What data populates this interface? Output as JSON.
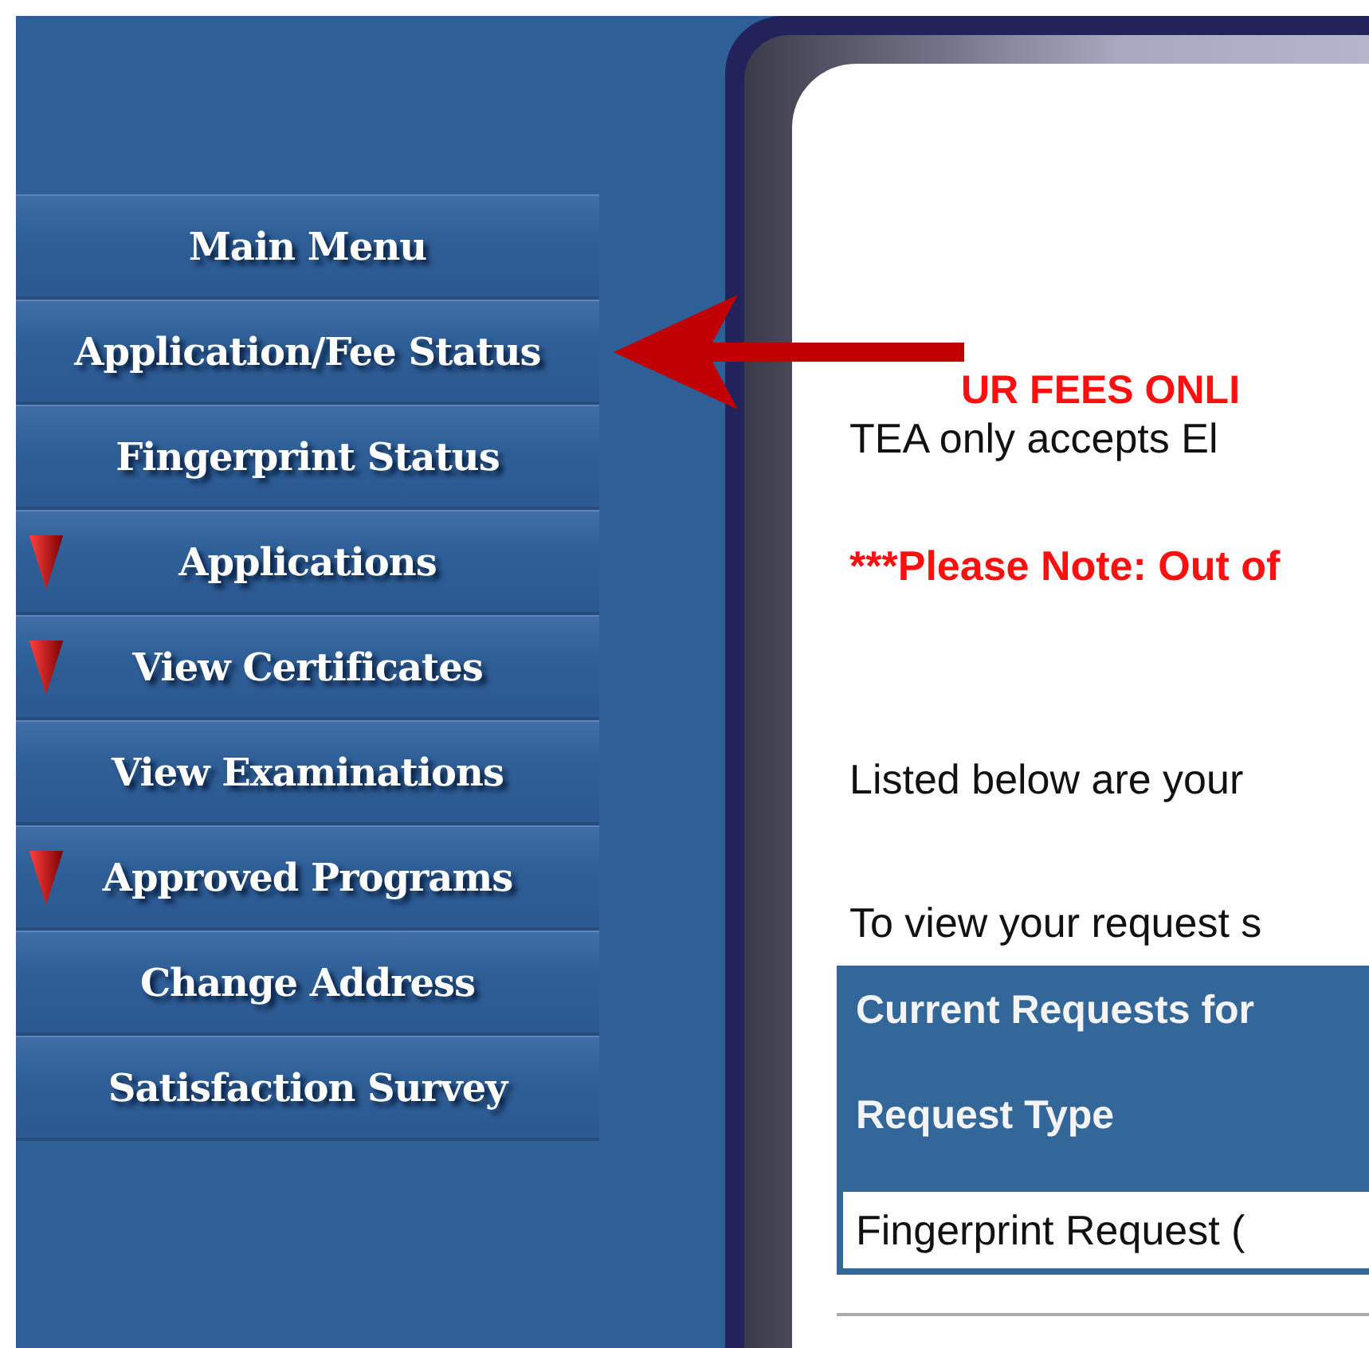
{
  "sidebar": {
    "items": [
      {
        "label": "Main Menu",
        "kind": "link"
      },
      {
        "label": "Application/Fee Status",
        "kind": "link"
      },
      {
        "label": "Fingerprint Status",
        "kind": "link"
      },
      {
        "label": "Applications",
        "kind": "expandable"
      },
      {
        "label": "View Certificates",
        "kind": "expandable"
      },
      {
        "label": "View Examinations",
        "kind": "link"
      },
      {
        "label": "Approved Programs",
        "kind": "expandable"
      },
      {
        "label": "Change Address",
        "kind": "link"
      },
      {
        "label": "Satisfaction Survey",
        "kind": "link"
      }
    ]
  },
  "content": {
    "fee_notice": "UR FEES ONLI",
    "fee_text": "TEA only accepts El",
    "note": "***Please Note: Out of",
    "listed_text": "Listed below are your",
    "view_text": "To view your request s",
    "table": {
      "title": "Current Requests for",
      "columns": [
        "Request Type"
      ],
      "rows": [
        [
          "Fingerprint Request ("
        ]
      ]
    }
  }
}
